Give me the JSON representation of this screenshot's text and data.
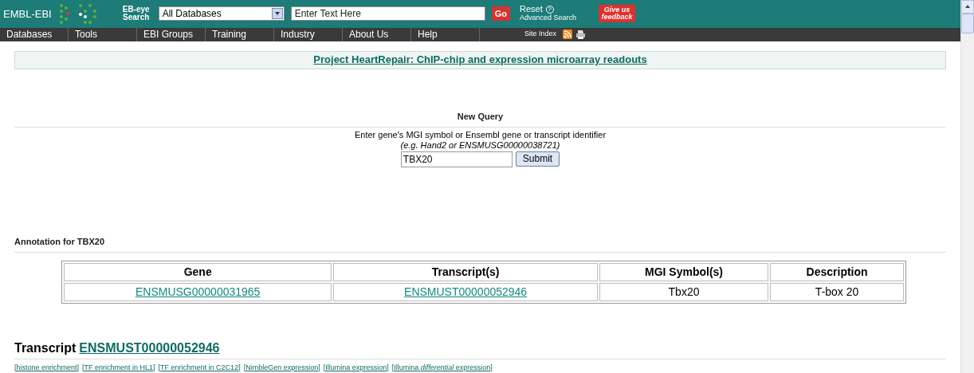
{
  "header": {
    "logo": "EMBL-EBI",
    "search_label": "EB-eye Search",
    "database_select": "All Databases",
    "search_field": {
      "placeholder": "Enter Text Here"
    },
    "go_button": "Go",
    "reset": "Reset",
    "help_mark": "?",
    "advanced_search": "Advanced Search",
    "feedback": "Give us feedback"
  },
  "nav": {
    "items": [
      "Databases",
      "Tools",
      "EBI Groups",
      "Training",
      "Industry",
      "About Us",
      "Help"
    ],
    "site_index": "Site Index"
  },
  "banner": "Project HeartRepair: ChIP-chip and expression microarray readouts",
  "query": {
    "heading": "New Query",
    "instruction": "Enter gene's MGI symbol or Ensembl gene or transcript identifier",
    "hint": "(*e.g.* Hand2 *or* ENSMUSG00000038721)",
    "input": "TBX20",
    "submit": "Submit"
  },
  "annotation": {
    "heading": "Annotation for TBX20",
    "columns": [
      "Gene",
      "Transcript(s)",
      "MGI Symbol(s)",
      "Description"
    ],
    "rows": [
      [
        {
          "text": "ENSMUSG00000031965",
          "link": true
        },
        {
          "text": "ENSMUST00000052946",
          "link": true
        },
        {
          "text": "Tbx20",
          "link": false
        },
        {
          "text": "T-box 20",
          "link": false
        }
      ]
    ]
  },
  "transcript": {
    "label": "Transcript",
    "id": "ENSMUST00000052946",
    "links": [
      "[histone enrichment]",
      "[TF enrichment in HL1]",
      "[TF enrichment in C2C12]",
      "[NimbleGen expression]",
      "[Illumina expression]",
      "[Illumina *differential* expression]"
    ]
  }
}
